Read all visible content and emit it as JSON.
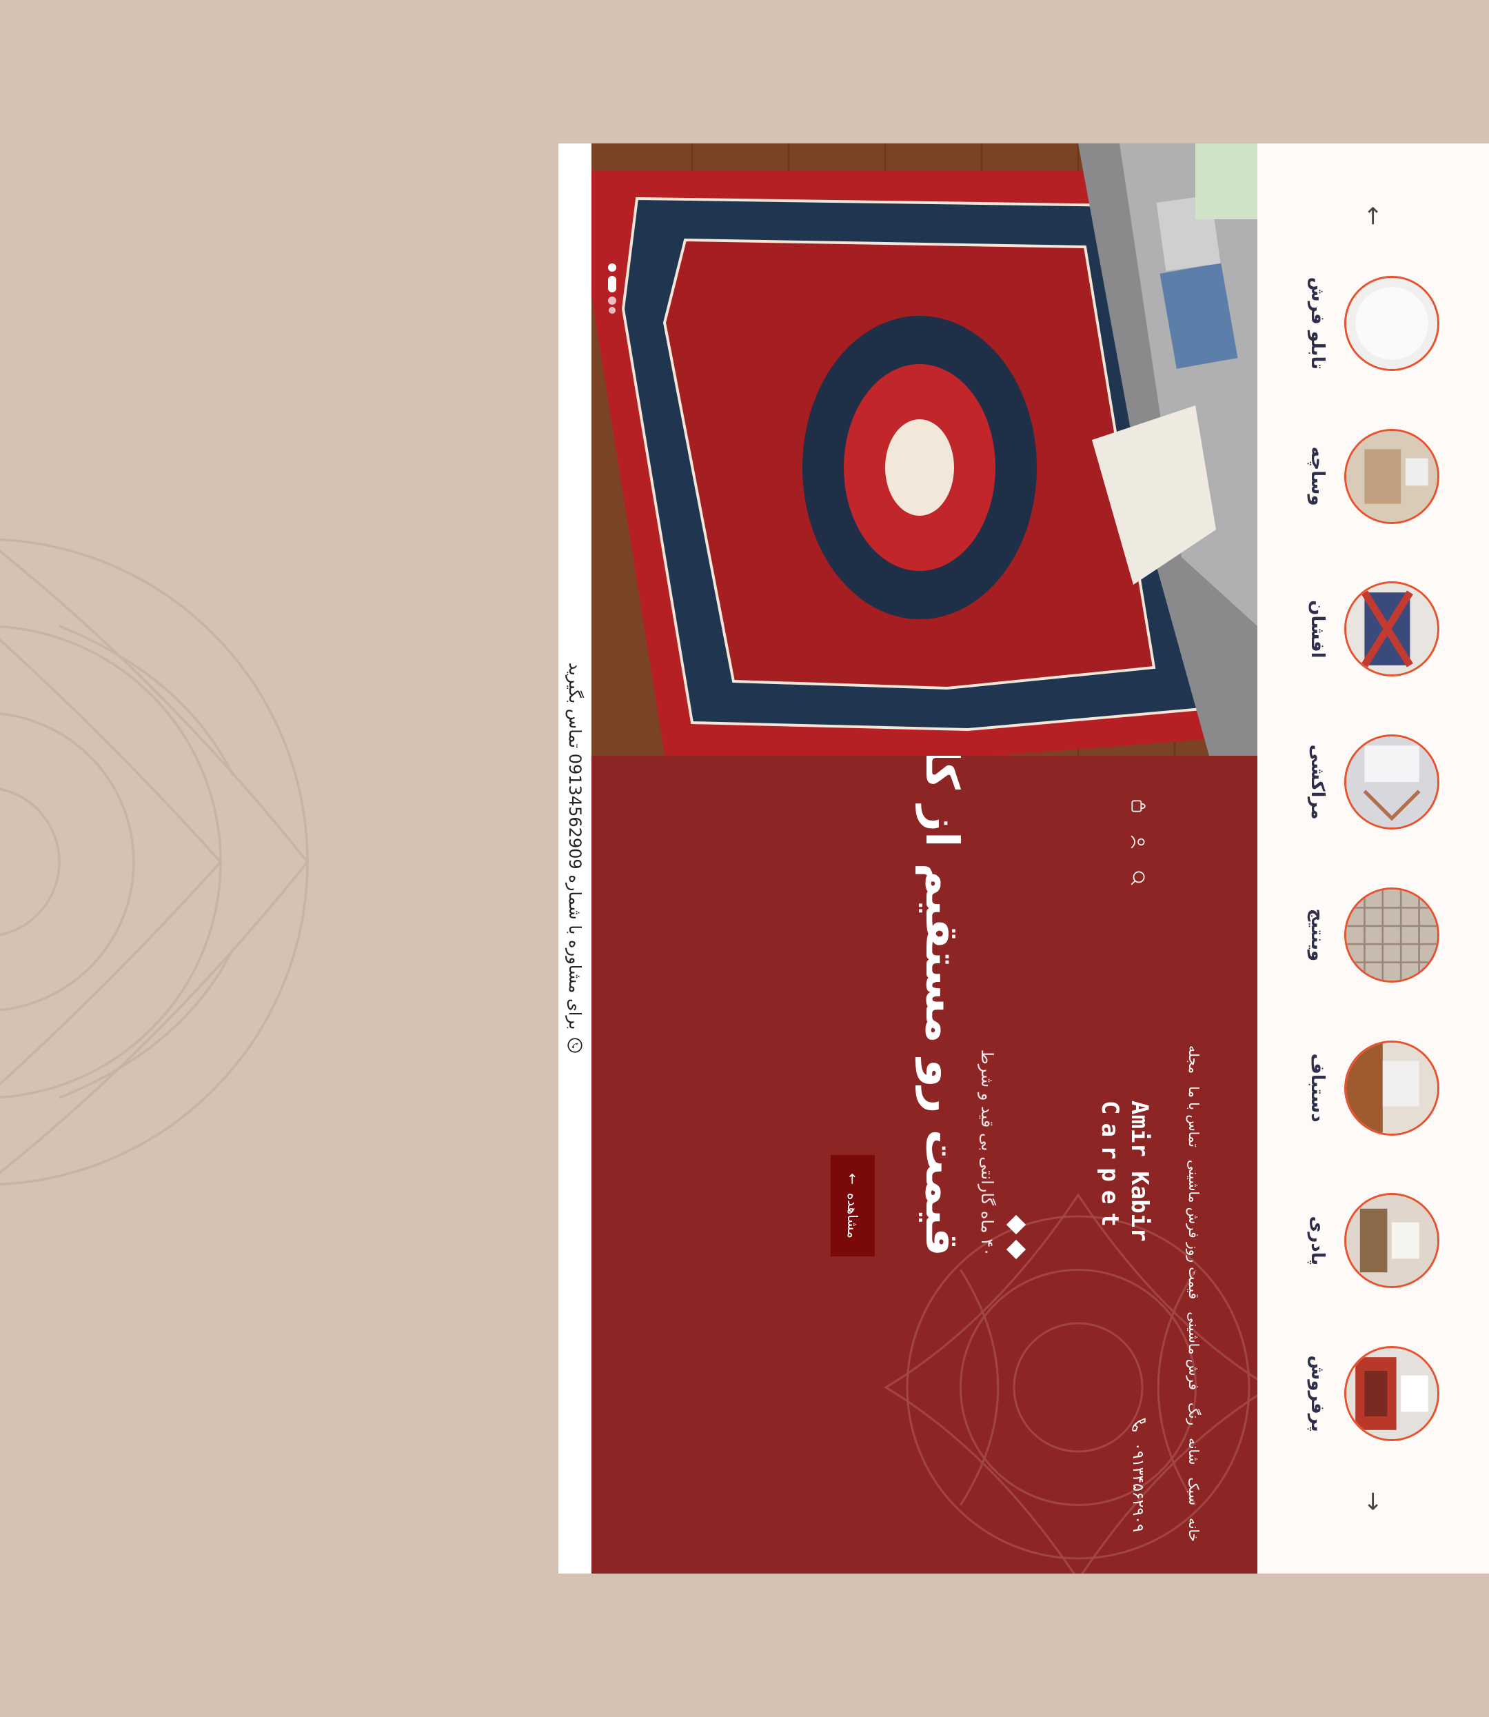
{
  "topbar": {
    "consult_text": "برای مشاوره با شماره 09134562909 تماس بگیرید",
    "icon": "whatsapp-icon"
  },
  "header": {
    "logo_line1": "Amir Kabir",
    "logo_line2": "Carpet",
    "phone": "۰۹۱۳۴۵۶۲۹۰۹",
    "nav": [
      "خانه",
      "سبک",
      "شانه",
      "رنگ",
      "فرش ماشینی",
      "قیمت روز فرش ماشینی",
      "تماس با ما",
      "مجله"
    ]
  },
  "hero": {
    "subtitle": "۴۰ ماه گارانتی بی قید و شرط",
    "title": "قیمت رو مستقیم از کارخونه بخر",
    "button_label": "مشاهده"
  },
  "categories": {
    "items": [
      {
        "label": "پرفروش",
        "color": "#b8382a"
      },
      {
        "label": "پادری",
        "color": "#8a6a4a"
      },
      {
        "label": "دستباف",
        "color": "#a05a30"
      },
      {
        "label": "وینتیج",
        "color": "#c8bcb0"
      },
      {
        "label": "مراکشی",
        "color": "#d8d8dc"
      },
      {
        "label": "افشان",
        "color": "#3a4a7a"
      },
      {
        "label": "وساچه",
        "color": "#c0a080"
      },
      {
        "label": "تابلو فرش",
        "color": "#f0efee"
      }
    ]
  },
  "colors": {
    "accent_red": "#8c2524",
    "button_red": "#7a0a0a",
    "circle_border": "#e5532f",
    "page_bg": "#d5c2b4"
  }
}
